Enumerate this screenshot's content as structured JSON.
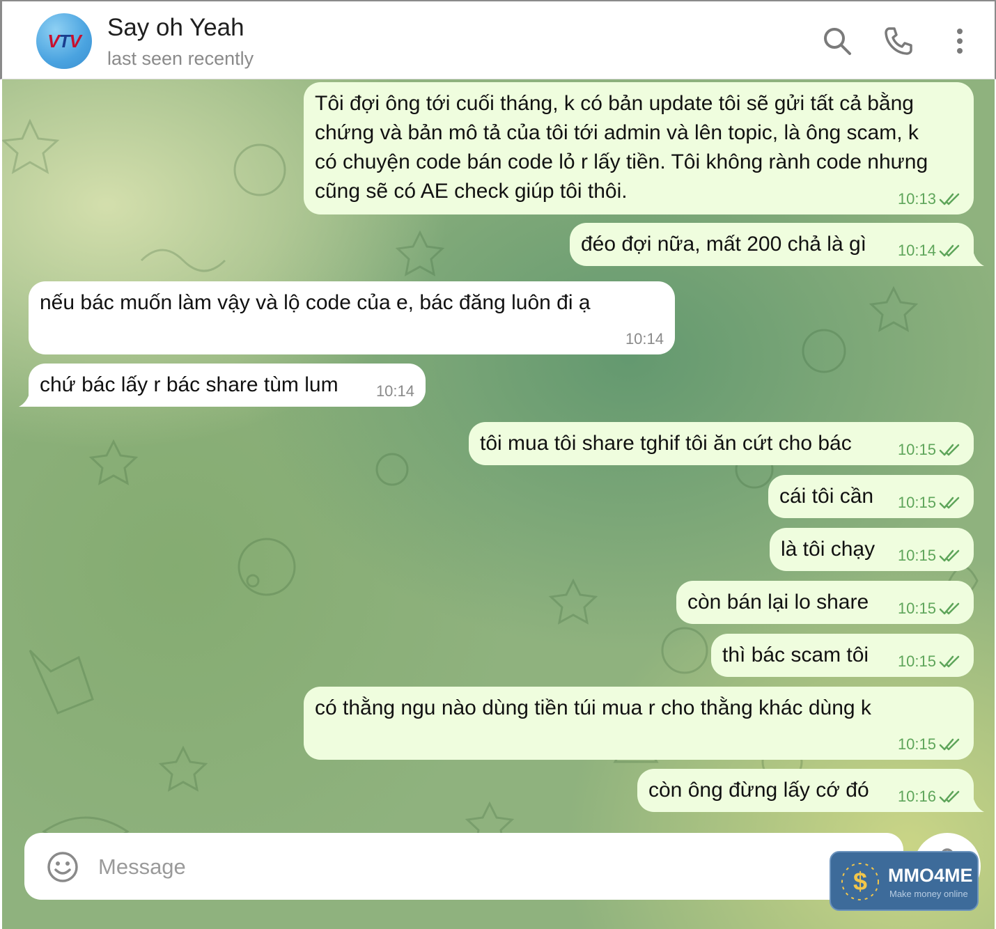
{
  "header": {
    "avatar_logo": "VTV",
    "title": "Say oh Yeah",
    "status": "last seen recently",
    "icons": [
      "search-icon",
      "phone-icon",
      "more-vertical-icon"
    ]
  },
  "messages": [
    {
      "dir": "out",
      "lines": [
        "Tôi đợi ông tới cuối tháng,  k có bản update tôi sẽ gửi tất cả bằng",
        "chứng và bản mô tả của tôi tới admin và lên topic, là ông scam, k",
        "có chuyện code bán code lỏ r lấy tiền. Tôi không rành code nhưng",
        "cũng sẽ có AE check giúp tôi thôi."
      ],
      "time": "10:13",
      "read": true
    },
    {
      "dir": "out",
      "lines": [
        "đéo đợi nữa, mất 200 chả là gì"
      ],
      "time": "10:14",
      "read": true
    },
    {
      "dir": "in",
      "lines": [
        "nếu bác muốn làm vậy và lộ code của e, bác đăng luôn đi ạ"
      ],
      "time": "10:14",
      "read": false
    },
    {
      "dir": "in",
      "lines": [
        "chứ bác lấy r bác share tùm lum"
      ],
      "time": "10:14",
      "read": false
    },
    {
      "dir": "out",
      "lines": [
        "tôi mua tôi share tghif tôi ăn cứt cho bác"
      ],
      "time": "10:15",
      "read": true
    },
    {
      "dir": "out",
      "lines": [
        "cái tôi cần"
      ],
      "time": "10:15",
      "read": true
    },
    {
      "dir": "out",
      "lines": [
        "là tôi chạy"
      ],
      "time": "10:15",
      "read": true
    },
    {
      "dir": "out",
      "lines": [
        "còn bán lại lo share"
      ],
      "time": "10:15",
      "read": true
    },
    {
      "dir": "out",
      "lines": [
        "thì bác scam tôi"
      ],
      "time": "10:15",
      "read": true
    },
    {
      "dir": "out",
      "lines": [
        "có thằng ngu nào dùng tiền túi mua r cho thằng khác dùng k"
      ],
      "time": "10:15",
      "read": true
    },
    {
      "dir": "out",
      "lines": [
        "còn ông đừng lấy cớ đó"
      ],
      "time": "10:16",
      "read": true
    }
  ],
  "composer": {
    "placeholder": "Message",
    "emoji_icon": "emoji-icon",
    "send_icon": "microphone-icon"
  },
  "watermark": {
    "title": "MMO4ME",
    "subtitle": "Make money online"
  },
  "colors": {
    "outgoing_bubble": "#effdde",
    "incoming_bubble": "#ffffff",
    "check_green": "#5ea55a"
  }
}
